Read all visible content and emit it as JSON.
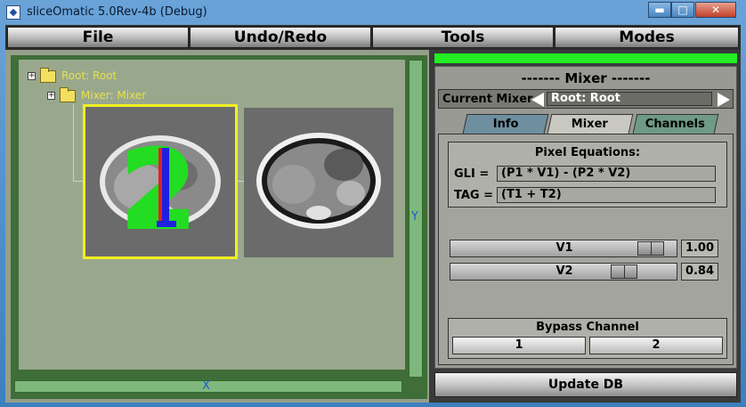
{
  "window": {
    "title": "sliceOmatic 5.0Rev-4b (Debug)",
    "controls": {
      "minimize": "▬",
      "maximize": "□",
      "close": "✕"
    }
  },
  "menu": [
    "File",
    "Undo/Redo",
    "Tools",
    "Modes"
  ],
  "tree": {
    "root_label": "Root: Root",
    "mixer_label": "Mixer: Mixer",
    "expander_glyph": "+"
  },
  "view": {
    "y_axis": "Y",
    "x_axis": "X",
    "overlay_text": "12"
  },
  "mixer": {
    "title": "------- Mixer -------",
    "current_mixer_label": "Current Mixer",
    "current_mixer_value": "Root: Root",
    "tabs": [
      "Info",
      "Mixer",
      "Channels"
    ],
    "pixel_equations_title": "Pixel Equations:",
    "gli_label": "GLI =",
    "gli_value": "(P1 * V1) - (P2 * V2)",
    "tag_label": "TAG =",
    "tag_value": "(T1 + T2)",
    "sliders": [
      {
        "name": "V1",
        "value": "1.00",
        "level": 1.0
      },
      {
        "name": "V2",
        "value": "0.84",
        "level": 0.84
      }
    ],
    "bypass_title": "Bypass Channel",
    "bypass_buttons": [
      "1",
      "2"
    ],
    "update_button": "Update DB"
  },
  "colors": {
    "status_bar": "#22ee22",
    "tree_text": "#e6e050",
    "selection_frame": "#f0f020",
    "axis_label": "#1d5ad8"
  }
}
